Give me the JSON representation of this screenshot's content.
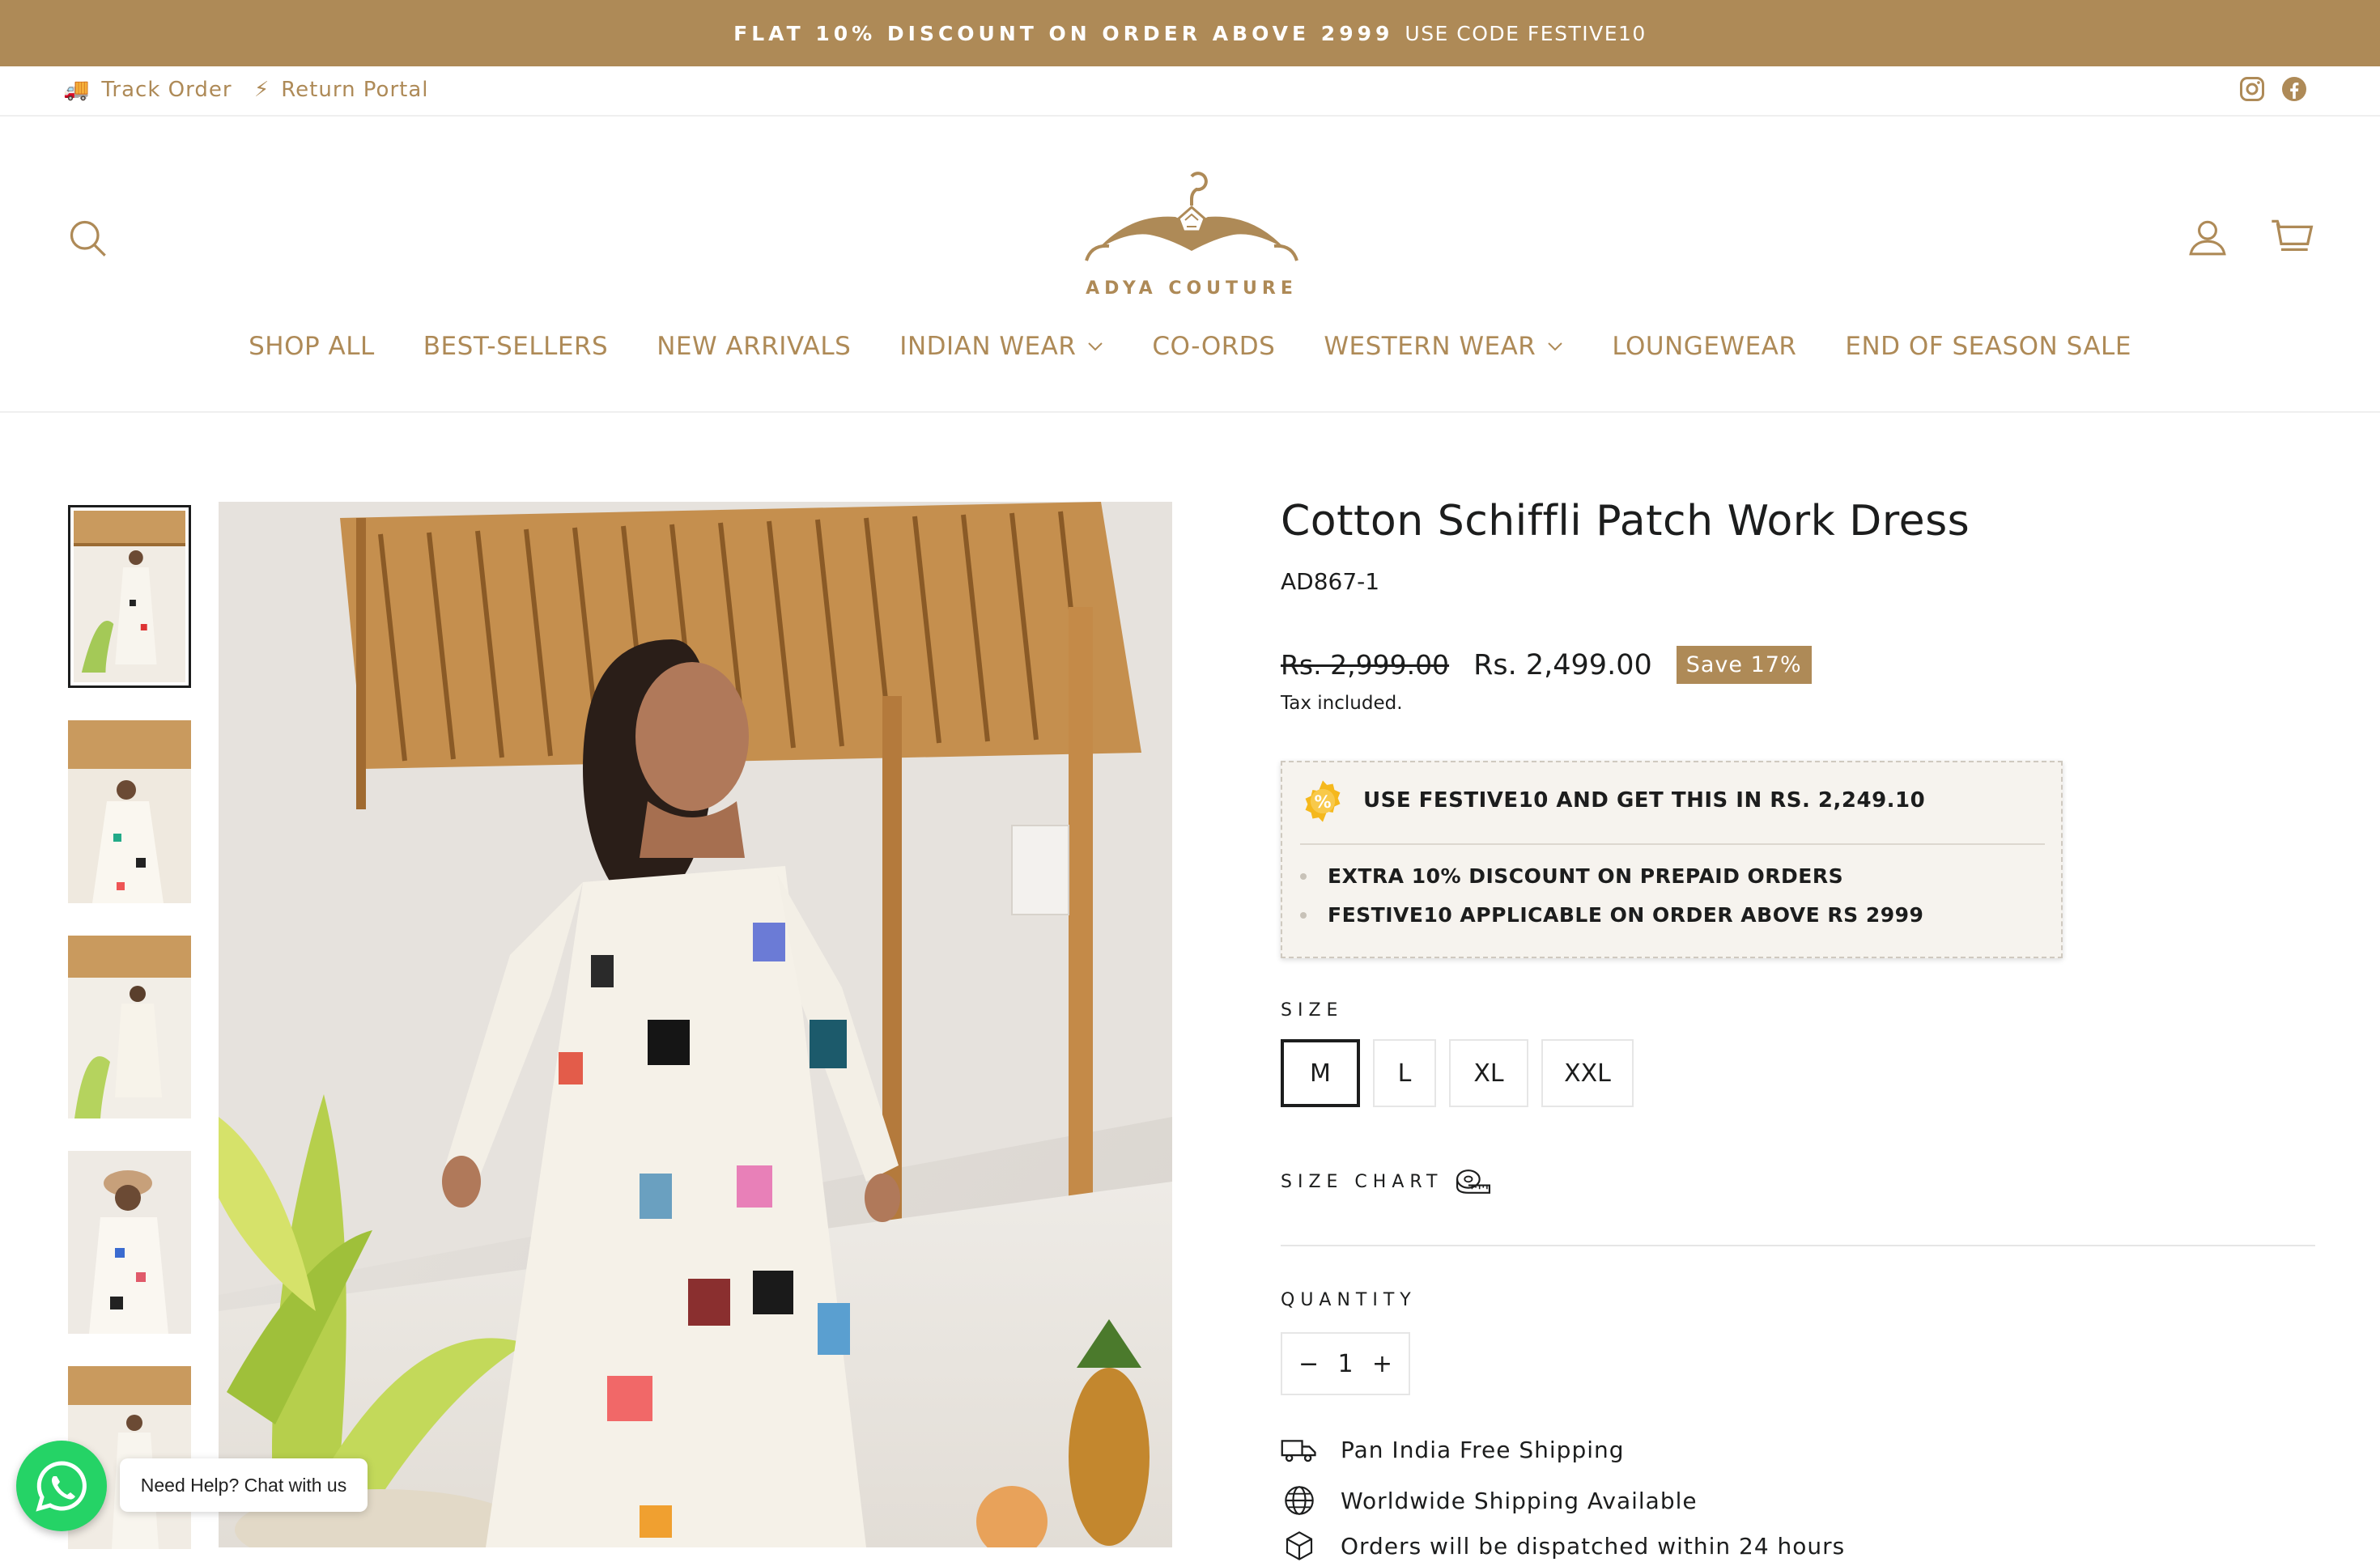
{
  "announcement": {
    "bold": "FLAT 10% DISCOUNT ON ORDER ABOVE 2999",
    "code": "USE CODE FESTIVE10"
  },
  "utility": {
    "track_order": "Track Order",
    "return_portal": "Return Portal",
    "truck_emoji": "🚚",
    "bolt_emoji": "⚡"
  },
  "brand": {
    "name": "ADYA COUTURE",
    "accent": "#ae8a57"
  },
  "nav": {
    "items": [
      {
        "label": "SHOP ALL"
      },
      {
        "label": "BEST-SELLERS"
      },
      {
        "label": "NEW ARRIVALS"
      },
      {
        "label": "INDIAN WEAR",
        "dropdown": true
      },
      {
        "label": "CO-ORDS"
      },
      {
        "label": "WESTERN WEAR",
        "dropdown": true
      },
      {
        "label": "LOUNGEWEAR"
      },
      {
        "label": "END OF SEASON SALE"
      }
    ]
  },
  "product": {
    "title": "Cotton Schiffli Patch Work Dress",
    "sku": "AD867-1",
    "compare_price": "Rs. 2,999.00",
    "price": "Rs. 2,499.00",
    "save": "Save 17%",
    "tax_note": "Tax included."
  },
  "offer": {
    "headline": "USE FESTIVE10 AND GET THIS IN RS. 2,249.10",
    "bullets": [
      "EXTRA 10% DISCOUNT ON PREPAID ORDERS",
      "FESTIVE10 APPLICABLE ON ORDER ABOVE RS 2999"
    ]
  },
  "size": {
    "label": "SIZE",
    "options": [
      "M",
      "L",
      "XL",
      "XXL"
    ],
    "selected": "M",
    "chart_label": "SIZE CHART"
  },
  "quantity": {
    "label": "QUANTITY",
    "value": "1",
    "minus": "−",
    "plus": "+"
  },
  "features": [
    "Pan India Free Shipping",
    "Worldwide Shipping Available",
    "Orders will be dispatched within 24 hours"
  ],
  "whatsapp": {
    "tooltip": "Need Help? Chat with us"
  }
}
